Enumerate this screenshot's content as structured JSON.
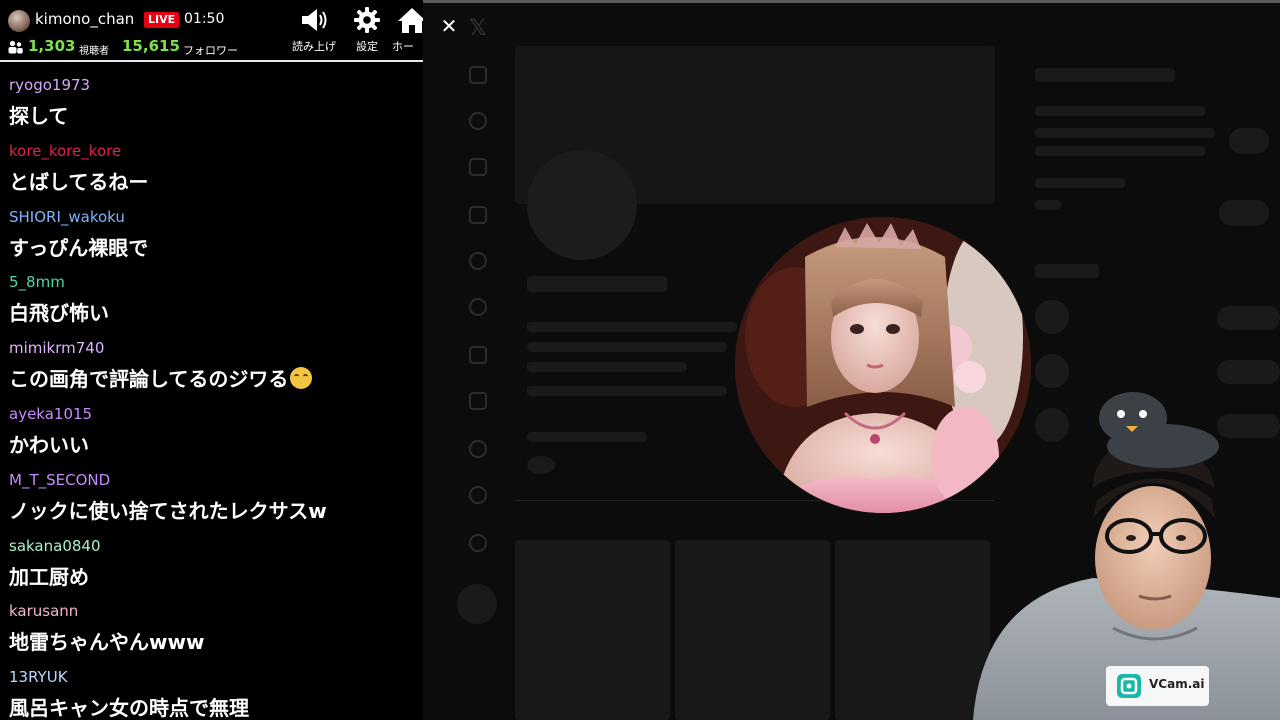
{
  "header": {
    "channel_name": "kimono_chan",
    "live_label": "LIVE",
    "elapsed": "01:50",
    "viewers": "1,303",
    "viewers_label": "視聴者",
    "followers": "15,615",
    "followers_label": "フォロワー",
    "tools": {
      "read_aloud": "読み上げ",
      "settings": "設定",
      "home": "ホー"
    }
  },
  "colors": {
    "live": "#e60012",
    "counts": "#7ee04a"
  },
  "chat": {
    "messages": [
      {
        "user": "ryogo1973",
        "text": "探して",
        "color": "#d7a8ff"
      },
      {
        "user": "kore_kore_kore",
        "text": "とばしてるねー",
        "color": "#e0204a"
      },
      {
        "user": "SHIORI_wakoku",
        "text": "すっぴん裸眼で",
        "color": "#7fb2ff"
      },
      {
        "user": "5_8mm",
        "text": "白飛び怖い",
        "color": "#48d9a6"
      },
      {
        "user": "mimikrm740",
        "text": "この画角で評論してるのジワる",
        "color": "#e0b3ff",
        "emoji": "joy-emoji"
      },
      {
        "user": "ayeka1015",
        "text": "かわいい",
        "color": "#c58bff"
      },
      {
        "user": "M_T_SECOND",
        "text": "ノックに使い捨てされたレクサスw",
        "color": "#c58bff"
      },
      {
        "user": "sakana0840",
        "text": "加工厨め",
        "color": "#a8f0c8"
      },
      {
        "user": "karusann",
        "text": "地雷ちゃんやんwww",
        "color": "#f0b8c8"
      },
      {
        "user": "13RYUK",
        "text": "風呂キャン女の時点で無理",
        "color": "#b8d8ff"
      }
    ]
  },
  "overlay": {
    "close_icon": "close-icon",
    "vcam_label": "VCam.ai"
  }
}
